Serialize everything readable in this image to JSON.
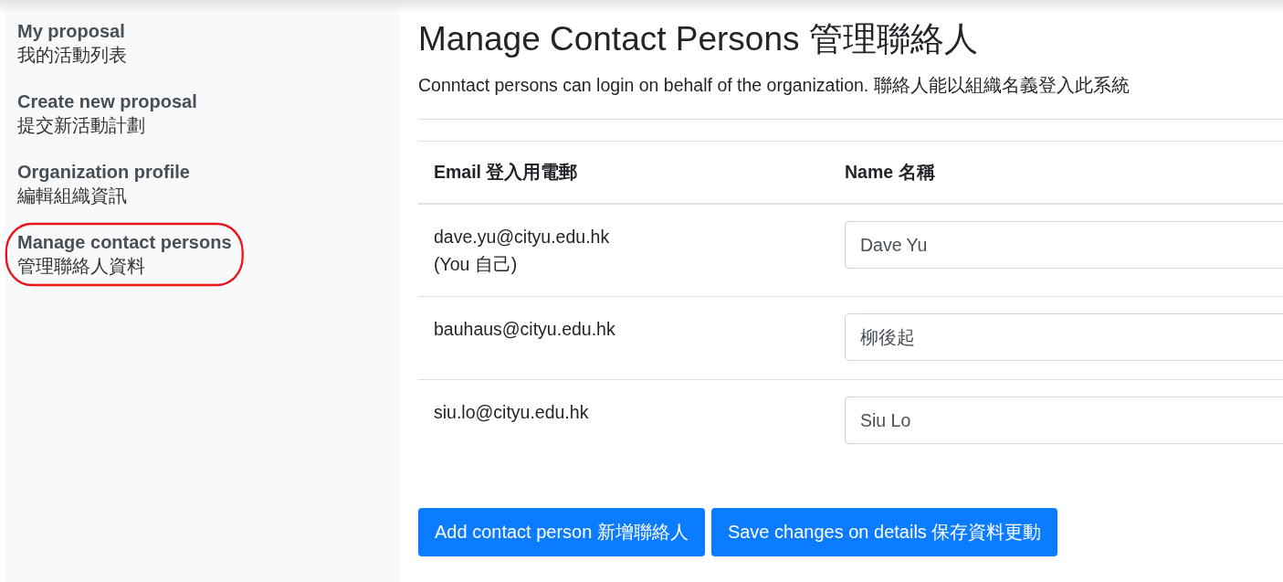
{
  "sidebar": {
    "items": [
      {
        "label": "My proposal",
        "sublabel": "我的活動列表",
        "selected": false
      },
      {
        "label": "Create new proposal",
        "sublabel": "提交新活動計劃",
        "selected": false
      },
      {
        "label": "Organization profile",
        "sublabel": "編輯組織資訊",
        "selected": false
      },
      {
        "label": "Manage contact persons",
        "sublabel": "管理聯絡人資料",
        "selected": true
      }
    ]
  },
  "page": {
    "title": "Manage Contact Persons 管理聯絡人",
    "description": "Conntact persons can login on behalf of the organization. 聯絡人能以組織名義登入此系統"
  },
  "table": {
    "columns": [
      "Email 登入用電郵",
      "Name 名稱"
    ],
    "rows": [
      {
        "email": "dave.yu@cityu.edu.hk",
        "note": "(You 自己)",
        "name": "Dave Yu"
      },
      {
        "email": "bauhaus@cityu.edu.hk",
        "name": "柳後起"
      },
      {
        "email": "siu.lo@cityu.edu.hk",
        "name": "Siu Lo"
      }
    ]
  },
  "buttons": [
    "Add contact person 新增聯絡人",
    "Save changes on details 保存資料更動"
  ]
}
